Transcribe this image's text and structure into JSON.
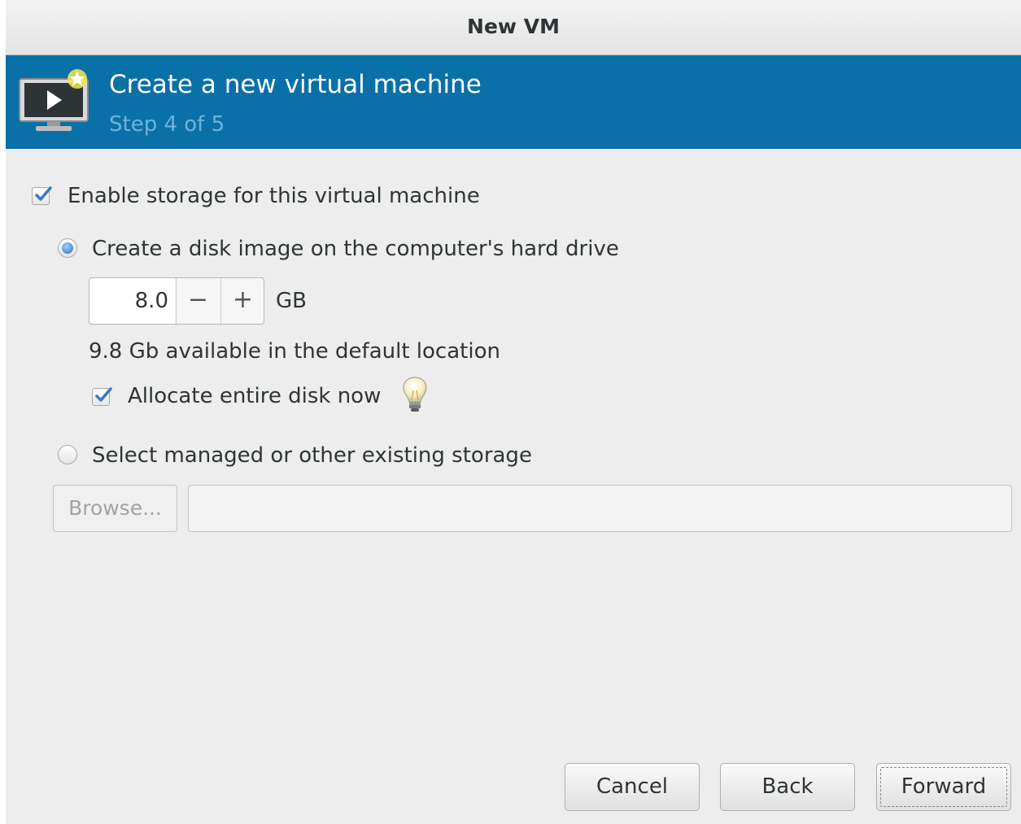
{
  "window": {
    "title": "New VM"
  },
  "banner": {
    "heading": "Create a new virtual machine",
    "step": "Step 4 of 5",
    "icon": "vm-monitor-icon",
    "bg_color": "#0a70a8"
  },
  "storage": {
    "enable_label": "Enable storage for this virtual machine",
    "enable_checked": true,
    "create_option_label": "Create a disk image on the computer's hard drive",
    "create_option_selected": true,
    "size_value": "8.0",
    "size_unit": "GB",
    "decrement_symbol": "−",
    "increment_symbol": "+",
    "available_text": "9.8 Gb available in the default location",
    "allocate_label": "Allocate entire disk now",
    "allocate_checked": true,
    "hint_icon": "lightbulb-icon",
    "existing_option_label": "Select managed or other existing storage",
    "existing_option_selected": false,
    "browse_label": "Browse...",
    "path_value": ""
  },
  "buttons": {
    "cancel": "Cancel",
    "back": "Back",
    "forward": "Forward"
  }
}
